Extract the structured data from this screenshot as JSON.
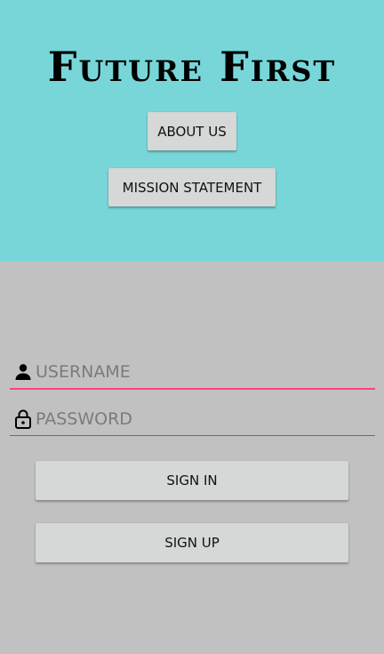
{
  "app": {
    "title": "Future First"
  },
  "header": {
    "about_label": "ABOUT US",
    "mission_label": "MISSION STATEMENT"
  },
  "login": {
    "username": {
      "value": "",
      "placeholder": "USERNAME",
      "icon": "person-icon"
    },
    "password": {
      "value": "",
      "placeholder": "PASSWORD",
      "icon": "lock-icon"
    },
    "signin_label": "SIGN IN",
    "signup_label": "SIGN UP"
  },
  "colors": {
    "header_bg": "#78d6d8",
    "body_bg": "#c1c1c1",
    "button_bg": "#d6d7d7",
    "focus_underline": "#ff4081"
  }
}
